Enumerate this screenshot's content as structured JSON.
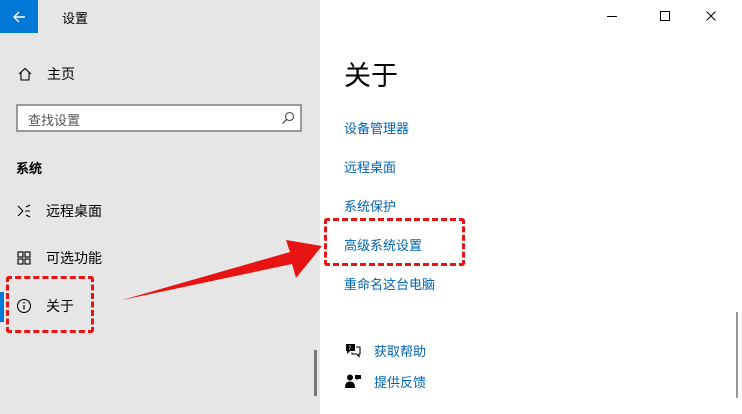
{
  "window": {
    "title": "设置"
  },
  "sidebar": {
    "home_label": "主页",
    "search_placeholder": "查找设置",
    "section_label": "系统",
    "items": [
      {
        "label": "远程桌面",
        "icon": "remote-desktop-icon"
      },
      {
        "label": "可选功能",
        "icon": "optional-features-icon"
      },
      {
        "label": "关于",
        "icon": "info-icon",
        "selected": true
      }
    ]
  },
  "main": {
    "title": "关于",
    "links": [
      {
        "label": "设备管理器"
      },
      {
        "label": "远程桌面"
      },
      {
        "label": "系统保护"
      },
      {
        "label": "高级系统设置",
        "highlighted": true
      },
      {
        "label": "重命名这台电脑"
      }
    ],
    "help_links": [
      {
        "label": "获取帮助",
        "icon": "help-chat-icon"
      },
      {
        "label": "提供反馈",
        "icon": "feedback-person-icon"
      }
    ]
  },
  "colors": {
    "accent": "#0078d7",
    "link": "#0063b1",
    "annotation": "#e81414",
    "sidebar_bg": "#e6e6e6"
  }
}
